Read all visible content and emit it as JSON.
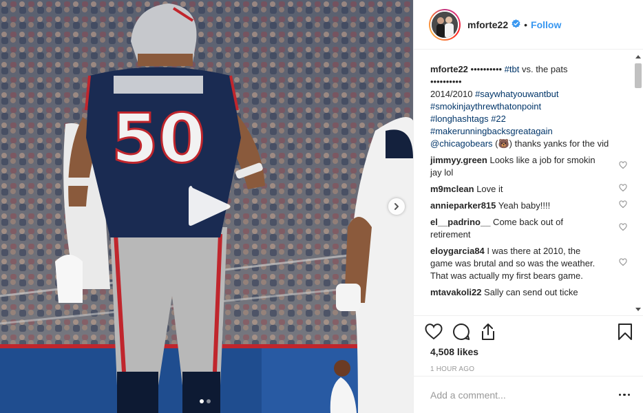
{
  "post": {
    "username": "mforte22",
    "separator": "•",
    "follow_label": "Follow"
  },
  "media": {
    "play_icon": "play-icon",
    "next_icon": "chevron-right-icon",
    "jersey_number": "50",
    "slide_count": 2,
    "active_slide": 1
  },
  "caption": {
    "username": "mforte22",
    "line1_rest": " •••••••••• ",
    "tag_tbt": "#tbt",
    "line1_tail": " vs. the pats",
    "line2": "••••••••••",
    "line3_prefix": "2014/2010 ",
    "tag_saywhat": "#saywhatyouwantbut",
    "tag_smokin": "#smokinjaythrewthatonpoint",
    "tag_long": "#longhashtags",
    "tag_22": " #22",
    "tag_mrbga": "#makerunningbacksgreatagain",
    "mention": "@chicagobears",
    "mention_tail_open": " (",
    "emoji_label": "🐻",
    "mention_tail": ") thanks yanks for the vid"
  },
  "comments": [
    {
      "user": "jimmyy.green",
      "text": " Looks like a job for smokin jay lol"
    },
    {
      "user": "m9mclean",
      "text": " Love it"
    },
    {
      "user": "annieparker815",
      "text": " Yeah baby!!!!"
    },
    {
      "user": "el__padrino__",
      "text": " Come back out of retirement"
    },
    {
      "user": "eloygarcia84",
      "text": " I was there at 2010, the game was brutal and so was the weather. That was actually my first bears game."
    },
    {
      "user": "mtavakoli22",
      "text": " Sally can send out ticke"
    }
  ],
  "actions": {
    "likes": "4,508 likes",
    "time": "1 HOUR AGO"
  },
  "add_comment": {
    "placeholder": "Add a comment..."
  },
  "colors": {
    "link": "#3897f0",
    "hashtag": "#003569",
    "muted": "#999999",
    "border": "#efefef"
  }
}
